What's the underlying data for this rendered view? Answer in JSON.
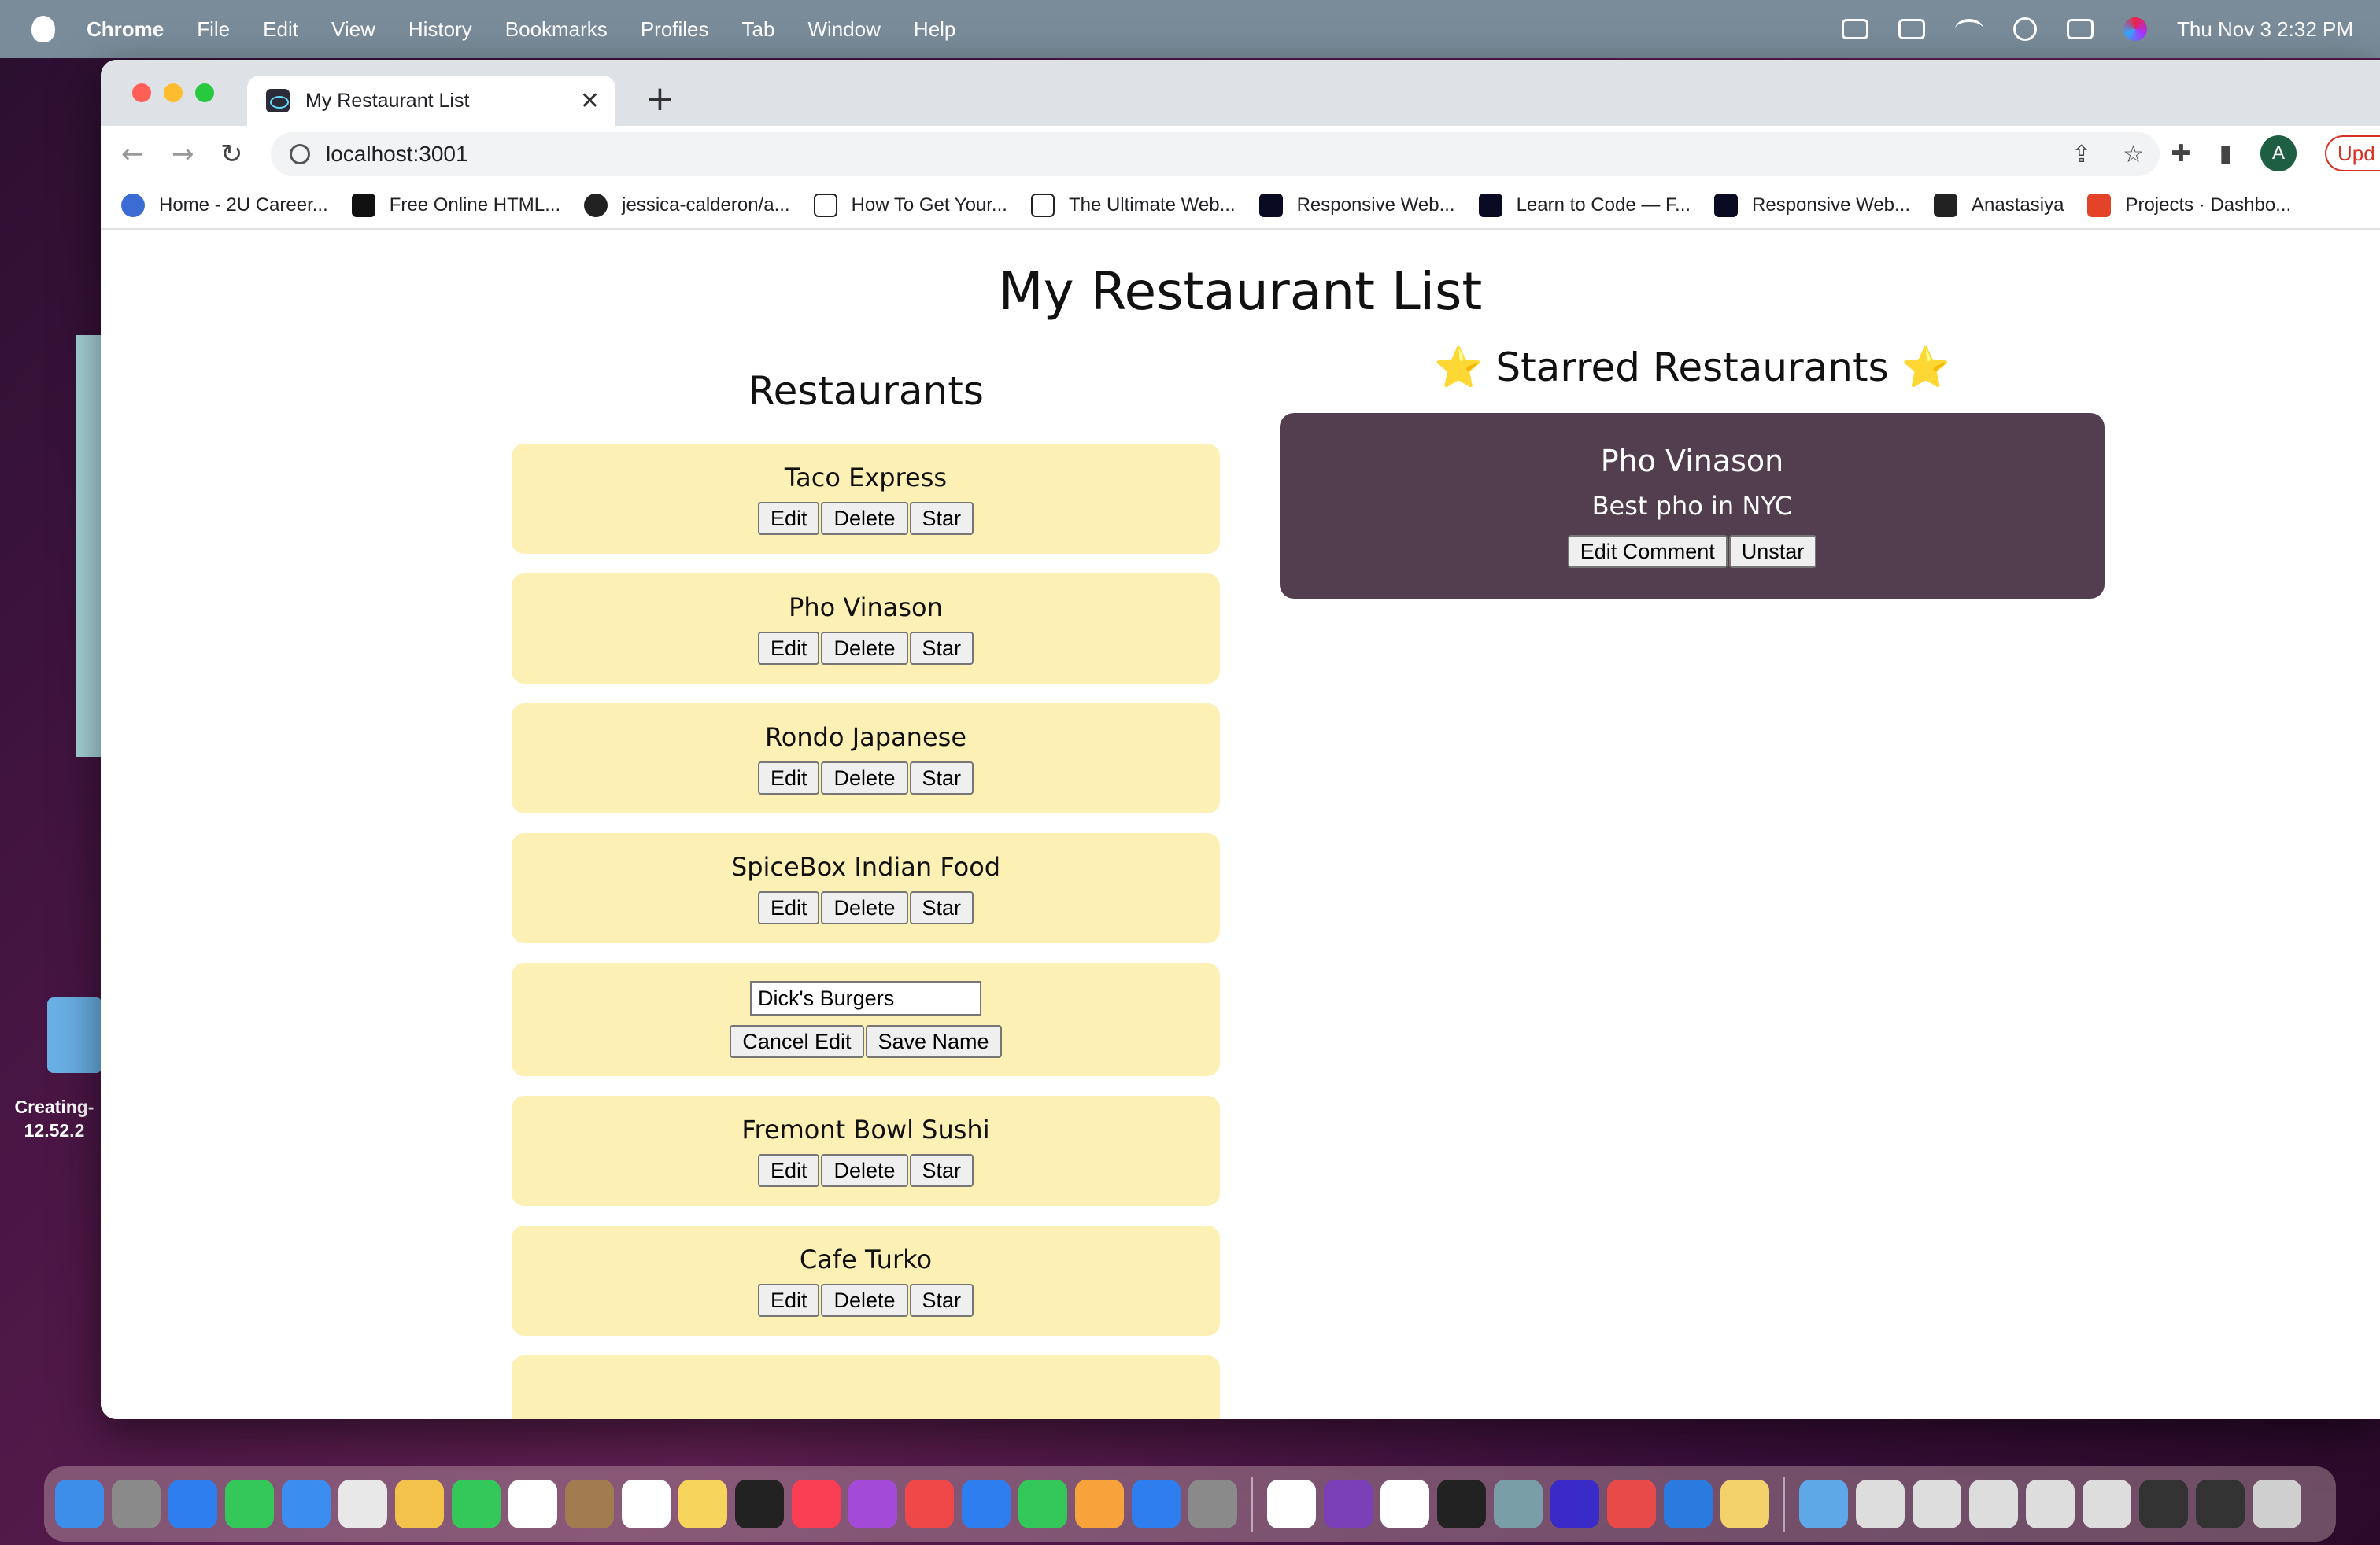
{
  "menubar": {
    "app": "Chrome",
    "items": [
      "File",
      "Edit",
      "View",
      "History",
      "Bookmarks",
      "Profiles",
      "Tab",
      "Window",
      "Help"
    ],
    "datetime": "Thu Nov 3  2:32 PM"
  },
  "desktop": {
    "file_label": "Creating-\n12.52.2"
  },
  "browser": {
    "tab_title": "My Restaurant List",
    "tab_close": "✕",
    "new_tab": "+",
    "url": "localhost:3001",
    "profile_initial": "A",
    "update_label": "Upd",
    "bookmarks": [
      {
        "label": "Home - 2U Career...",
        "color": "#3b6cd4"
      },
      {
        "label": "Free Online HTML...",
        "color": "#111111"
      },
      {
        "label": "jessica-calderon/a...",
        "color": "#222222"
      },
      {
        "label": "How To Get Your...",
        "color": "#ffffff"
      },
      {
        "label": "The Ultimate Web...",
        "color": "#ffffff"
      },
      {
        "label": "Responsive Web...",
        "color": "#0a0a23"
      },
      {
        "label": "Learn to Code — F...",
        "color": "#0a0a23"
      },
      {
        "label": "Responsive Web...",
        "color": "#0a0a23"
      },
      {
        "label": "Anastasiya",
        "color": "#222222"
      },
      {
        "label": "Projects · Dashbo...",
        "color": "#e24329"
      }
    ]
  },
  "page": {
    "title": "My Restaurant List",
    "restaurants_heading": "Restaurants",
    "starred_heading": "Starred Restaurants",
    "star_glyph": "⭐",
    "buttons": {
      "edit": "Edit",
      "delete": "Delete",
      "star": "Star",
      "cancel_edit": "Cancel Edit",
      "save_name": "Save Name",
      "edit_comment": "Edit Comment",
      "unstar": "Unstar"
    },
    "restaurants": [
      {
        "name": "Taco Express"
      },
      {
        "name": "Pho Vinason"
      },
      {
        "name": "Rondo Japanese"
      },
      {
        "name": "SpiceBox Indian Food"
      },
      {
        "name": "Dick's Burgers",
        "editing": true
      },
      {
        "name": "Fremont Bowl Sushi"
      },
      {
        "name": "Cafe Turko"
      }
    ],
    "starred": [
      {
        "name": "Pho Vinason",
        "comment": "Best pho in NYC"
      }
    ]
  },
  "dock": {
    "icons": [
      "finder-icon",
      "launchpad-icon",
      "safari-icon",
      "messages-icon",
      "mail-icon",
      "maps-icon",
      "photos-icon",
      "facetime-icon",
      "calendar-icon",
      "contacts-icon",
      "reminders-icon",
      "notes-icon",
      "tv-icon",
      "music-icon",
      "podcasts-icon",
      "news-icon",
      "keynote-icon",
      "numbers-icon",
      "pages-icon",
      "appstore-icon",
      "settings-icon",
      "slack-icon",
      "onenote-icon",
      "chrome-icon",
      "terminal-icon",
      "gitkraken-icon",
      "browser-icon",
      "spark-icon",
      "vscode-icon",
      "stickies-icon",
      "folder-icon",
      "doc-icon",
      "doc-icon",
      "doc-icon",
      "doc-icon",
      "doc-icon",
      "doc-icon",
      "doc-icon",
      "trash-icon"
    ],
    "colors": [
      "#3c8ee8",
      "#8a8a8a",
      "#2f7ef0",
      "#34c759",
      "#3b8ef0",
      "#e8e8e8",
      "#f3c24b",
      "#34c759",
      "#ffffff",
      "#a07c50",
      "#ffffff",
      "#f7d55c",
      "#222222",
      "#fa3e54",
      "#a34bd8",
      "#f04848",
      "#2f7ef0",
      "#34c759",
      "#f7a23b",
      "#2f7ef0",
      "#8a8a8a",
      "#ffffff",
      "#7b3fb7",
      "#ffffff",
      "#222222",
      "#7a9ea8",
      "#3a2ac8",
      "#e84a4a",
      "#2a7ae0",
      "#f3d26b",
      "#5fa8e8",
      "#dddddd",
      "#dddddd",
      "#dddddd",
      "#dddddd",
      "#dddddd",
      "#333333",
      "#333333",
      "#cfcfcf"
    ]
  }
}
